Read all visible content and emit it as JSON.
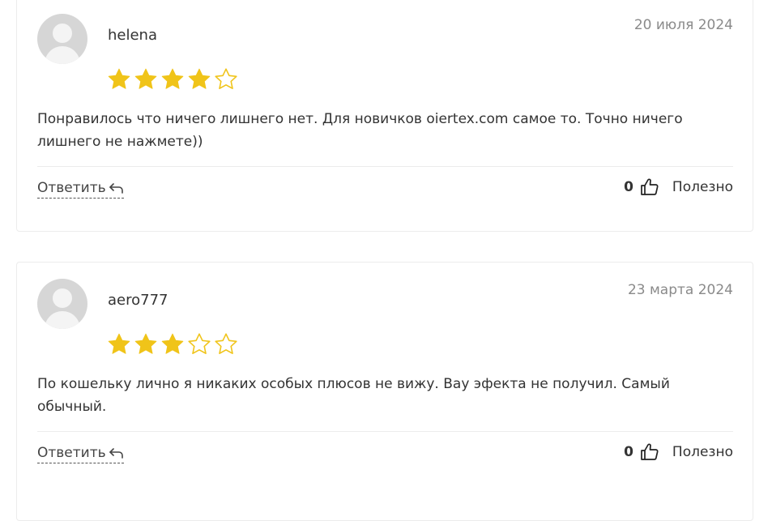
{
  "reviews": [
    {
      "author": "helena",
      "date": "20 июля 2024",
      "rating": 4,
      "max_rating": 5,
      "text": "Понравилось что ничего лишнего нет. Для новичков oiertex.com самое то. Точно ничего лишнего не нажмете))",
      "reply_label": "Ответить",
      "helpful_count": "0",
      "helpful_label": "Полезно"
    },
    {
      "author": "aero777",
      "date": "23 марта 2024",
      "rating": 3,
      "max_rating": 5,
      "text": "По кошельку лично я никаких особых плюсов не вижу. Вау эфекта не получил. Самый обычный.",
      "reply_label": "Ответить",
      "helpful_count": "0",
      "helpful_label": "Полезно"
    }
  ],
  "colors": {
    "star_filled": "#F0C419",
    "star_outline": "#F0C419",
    "date_text": "#8a8a8a"
  },
  "icons": {
    "star": "star-icon",
    "reply": "reply-arrow-icon",
    "helpful": "thumbs-up-icon",
    "avatar": "user-avatar-placeholder"
  }
}
